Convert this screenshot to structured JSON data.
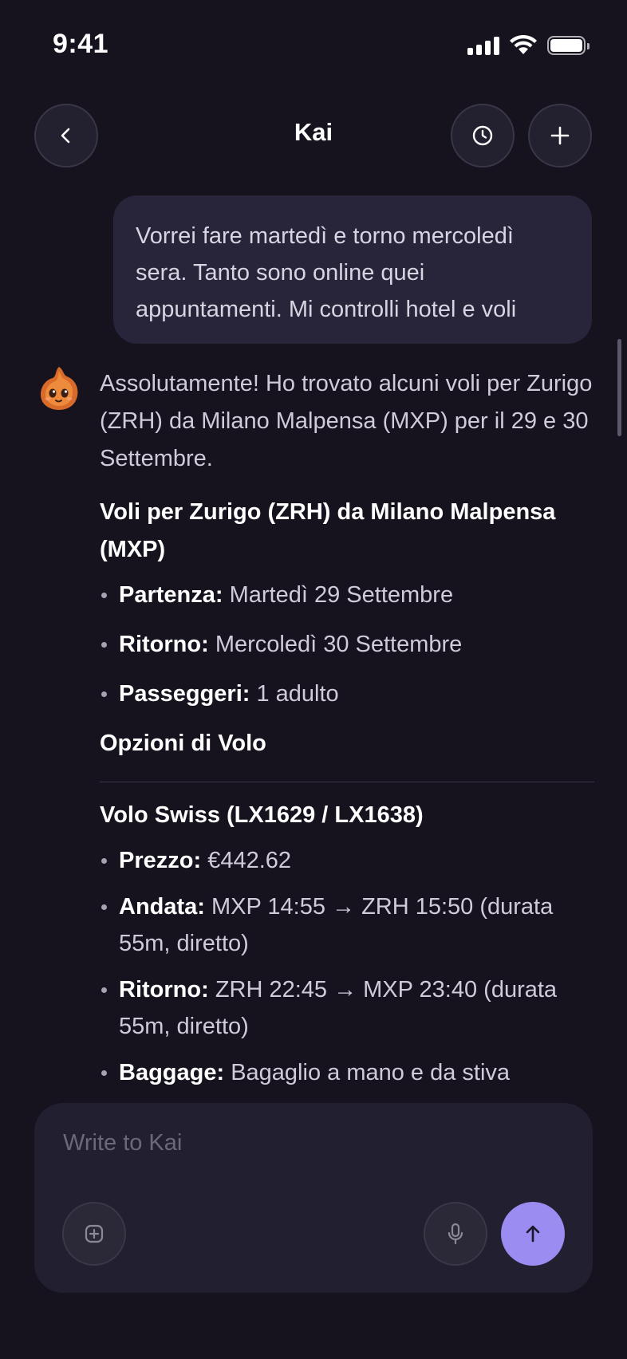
{
  "status": {
    "time": "9:41"
  },
  "header": {
    "title": "Kai",
    "back_icon": "chevron-left-icon",
    "history_icon": "clock-icon",
    "new_icon": "plus-icon"
  },
  "user_message": {
    "text": "Vorrei fare martedì e torno mercoledì sera. Tanto sono online quei appuntamenti. Mi controlli hotel e voli"
  },
  "assistant": {
    "intro": "Assolutamente! Ho trovato alcuni voli per Zurigo (ZRH) da Milano Malpensa (MXP) per il 29 e 30 Settembre.",
    "section1_title": "Voli per Zurigo (ZRH) da Milano Malpensa (MXP)",
    "section1_items": [
      {
        "label": "Partenza:",
        "value": "Martedì 29 Settembre"
      },
      {
        "label": "Ritorno:",
        "value": "Mercoledì 30 Settembre"
      },
      {
        "label": "Passeggeri:",
        "value": "1 adulto"
      }
    ],
    "section2_title": "Opzioni di Volo",
    "section3_title": "Volo Swiss (LX1629 / LX1638)",
    "section3_items": [
      {
        "label": "Prezzo:",
        "value": "€442.62"
      },
      {
        "label": "Andata:",
        "value": "MXP 14:55 → ZRH 15:50 (durata 55m, diretto)"
      },
      {
        "label": "Ritorno:",
        "value": "ZRH 22:45 → MXP 23:40 (durata 55m, diretto)"
      },
      {
        "label": "Baggage:",
        "value": "Bagaglio a mano e da stiva"
      }
    ]
  },
  "composer": {
    "placeholder": "Write to Kai",
    "attach_icon": "plus-square-icon",
    "mic_icon": "microphone-icon",
    "send_icon": "arrow-up-icon"
  },
  "colors": {
    "background": "#16131f",
    "bubble": "#28243a",
    "accent": "#9b8cf2"
  }
}
